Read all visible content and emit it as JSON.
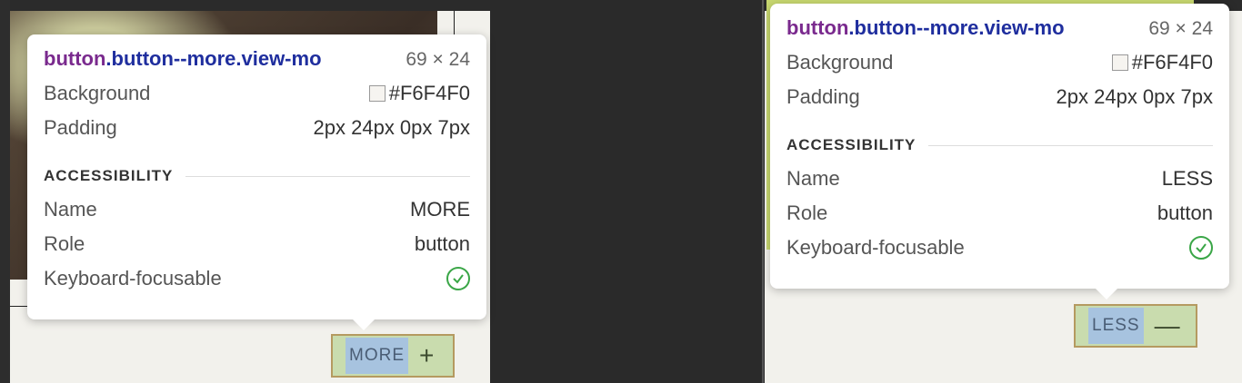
{
  "tooltips": [
    {
      "selector_tag": "button",
      "selector_class": ".button--more.view-mo",
      "size": "69 × 24",
      "background_label": "Background",
      "background_value": "#F6F4F0",
      "padding_label": "Padding",
      "padding_value": "2px 24px 0px 7px",
      "section_title": "ACCESSIBILITY",
      "name_label": "Name",
      "name_value": "MORE",
      "role_label": "Role",
      "role_value": "button",
      "focusable_label": "Keyboard-focusable"
    },
    {
      "selector_tag": "button",
      "selector_class": ".button--more.view-mo",
      "size": "69 × 24",
      "background_label": "Background",
      "background_value": "#F6F4F0",
      "padding_label": "Padding",
      "padding_value": "2px 24px 0px 7px",
      "section_title": "ACCESSIBILITY",
      "name_label": "Name",
      "name_value": "LESS",
      "role_label": "Role",
      "role_value": "button",
      "focusable_label": "Keyboard-focusable"
    }
  ],
  "buttons": {
    "more_label": "MORE",
    "more_symbol": "+",
    "less_label": "LESS",
    "less_symbol": "—"
  },
  "colors": {
    "swatch": "#F6F4F0",
    "check": "#3aa647"
  }
}
